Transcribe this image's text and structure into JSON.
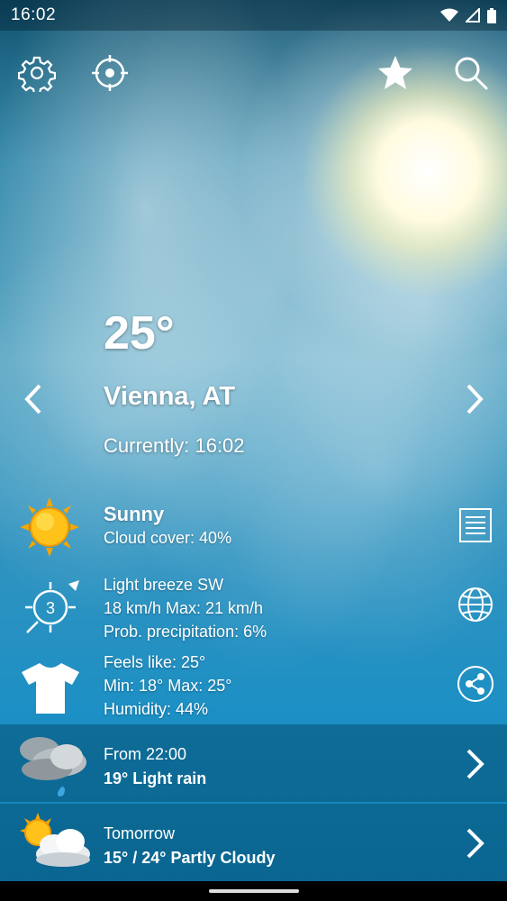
{
  "status_bar": {
    "time": "16:02"
  },
  "current": {
    "temperature": "25°",
    "city": "Vienna, AT",
    "currently": "Currently: 16:02"
  },
  "conditions": {
    "title": "Sunny",
    "cloud_cover": "Cloud cover: 40%"
  },
  "wind": {
    "beaufort": "3",
    "title": "Light breeze SW",
    "speed": "18 km/h Max: 21 km/h",
    "precipitation": "Prob. precipitation: 6%"
  },
  "comfort": {
    "feels_like": "Feels like: 25°",
    "min_max": "Min: 18° Max: 25°",
    "humidity": "Humidity: 44%"
  },
  "forecast": [
    {
      "when": "From 22:00",
      "summary": "19° Light rain"
    },
    {
      "when": "Tomorrow",
      "summary": "15° / 24° Partly Cloudy"
    }
  ],
  "icons": {
    "settings": "gear-icon",
    "locate": "crosshair-icon",
    "favorite": "star-icon",
    "search": "search-icon",
    "details": "document-icon",
    "map": "globe-icon",
    "share": "share-icon"
  }
}
